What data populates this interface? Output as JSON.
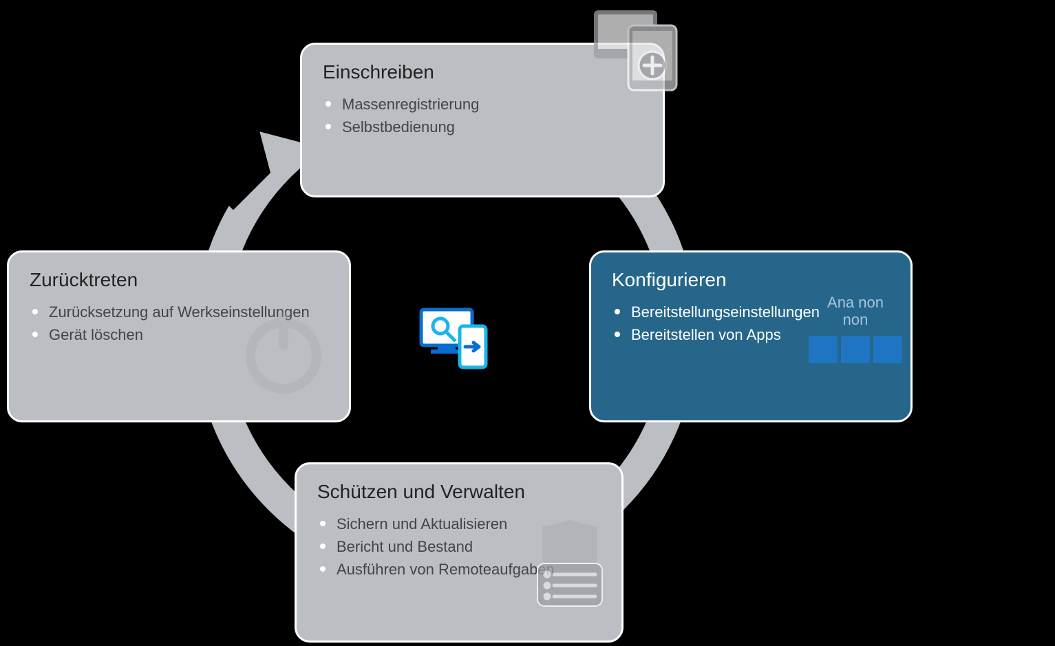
{
  "cards": {
    "top": {
      "title": "Einschreiben",
      "items": [
        "Massenregistrierung",
        "Selbstbedienung"
      ]
    },
    "right": {
      "title": "Konfigurieren",
      "items": [
        "Bereitstellungseinstellungen",
        "Bereitstellen von Apps"
      ],
      "badge_lines": [
        "Ana non",
        "non"
      ]
    },
    "bottom": {
      "title": "Schützen und Verwalten",
      "items": [
        "Sichern und Aktualisieren",
        "Bericht und Bestand",
        "Ausführen von Remoteaufgaben"
      ]
    },
    "left": {
      "title": "Zurücktreten",
      "items": [
        "Zurücksetzung auf Werkseinstellungen",
        "Gerät löschen"
      ]
    }
  }
}
